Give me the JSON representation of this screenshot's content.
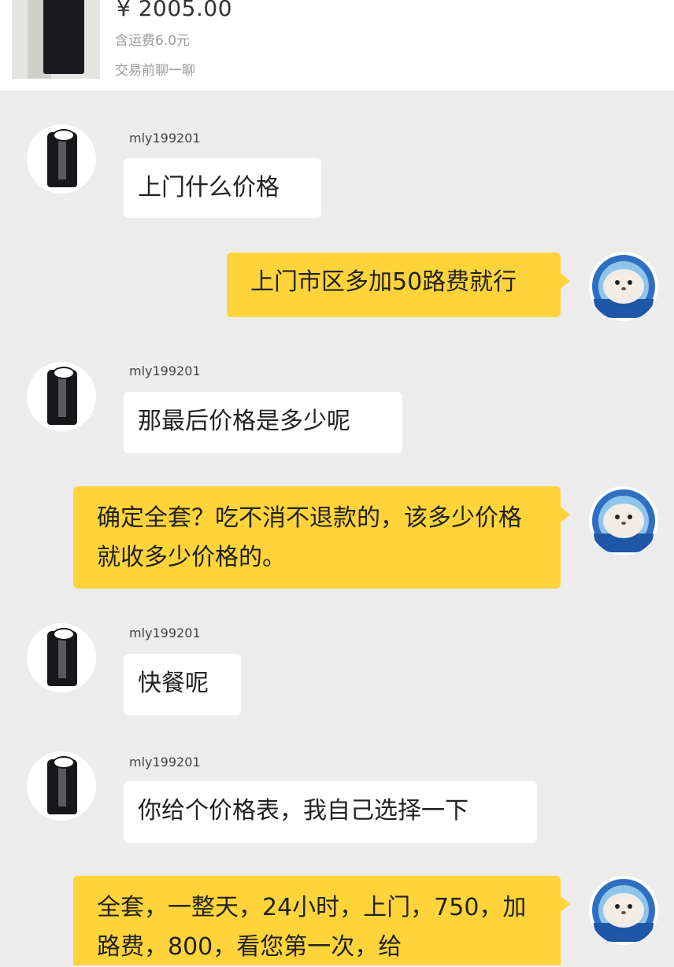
{
  "header": {
    "price": "¥ 2005.00",
    "shipping": "含运费6.0元",
    "chat_hint": "交易前聊一聊"
  },
  "messages": [
    {
      "side": "incoming",
      "username": "mly199201",
      "text": "上门什么价格"
    },
    {
      "side": "outgoing",
      "text": "上门市区多加50路费就行"
    },
    {
      "side": "incoming",
      "username": "mly199201",
      "text": "那最后价格是多少呢"
    },
    {
      "side": "outgoing",
      "text": "确定全套？吃不消不退款的，该多少价格就收多少价格的。"
    },
    {
      "side": "incoming",
      "username": "mly199201",
      "text": "快餐呢"
    },
    {
      "side": "incoming",
      "username": "mly199201",
      "text": "你给个价格表，我自己选择一下"
    },
    {
      "side": "outgoing",
      "text": "全套，一整天，24小时，上门，750，加路费，800，看您第一次，给"
    }
  ],
  "icons": {
    "incoming_avatar": "vest-avatar-icon",
    "outgoing_avatar": "seal-avatar-icon"
  },
  "colors": {
    "outgoing_bubble": "#ffd43a",
    "incoming_bubble": "#ffffff",
    "background": "#ececec"
  }
}
